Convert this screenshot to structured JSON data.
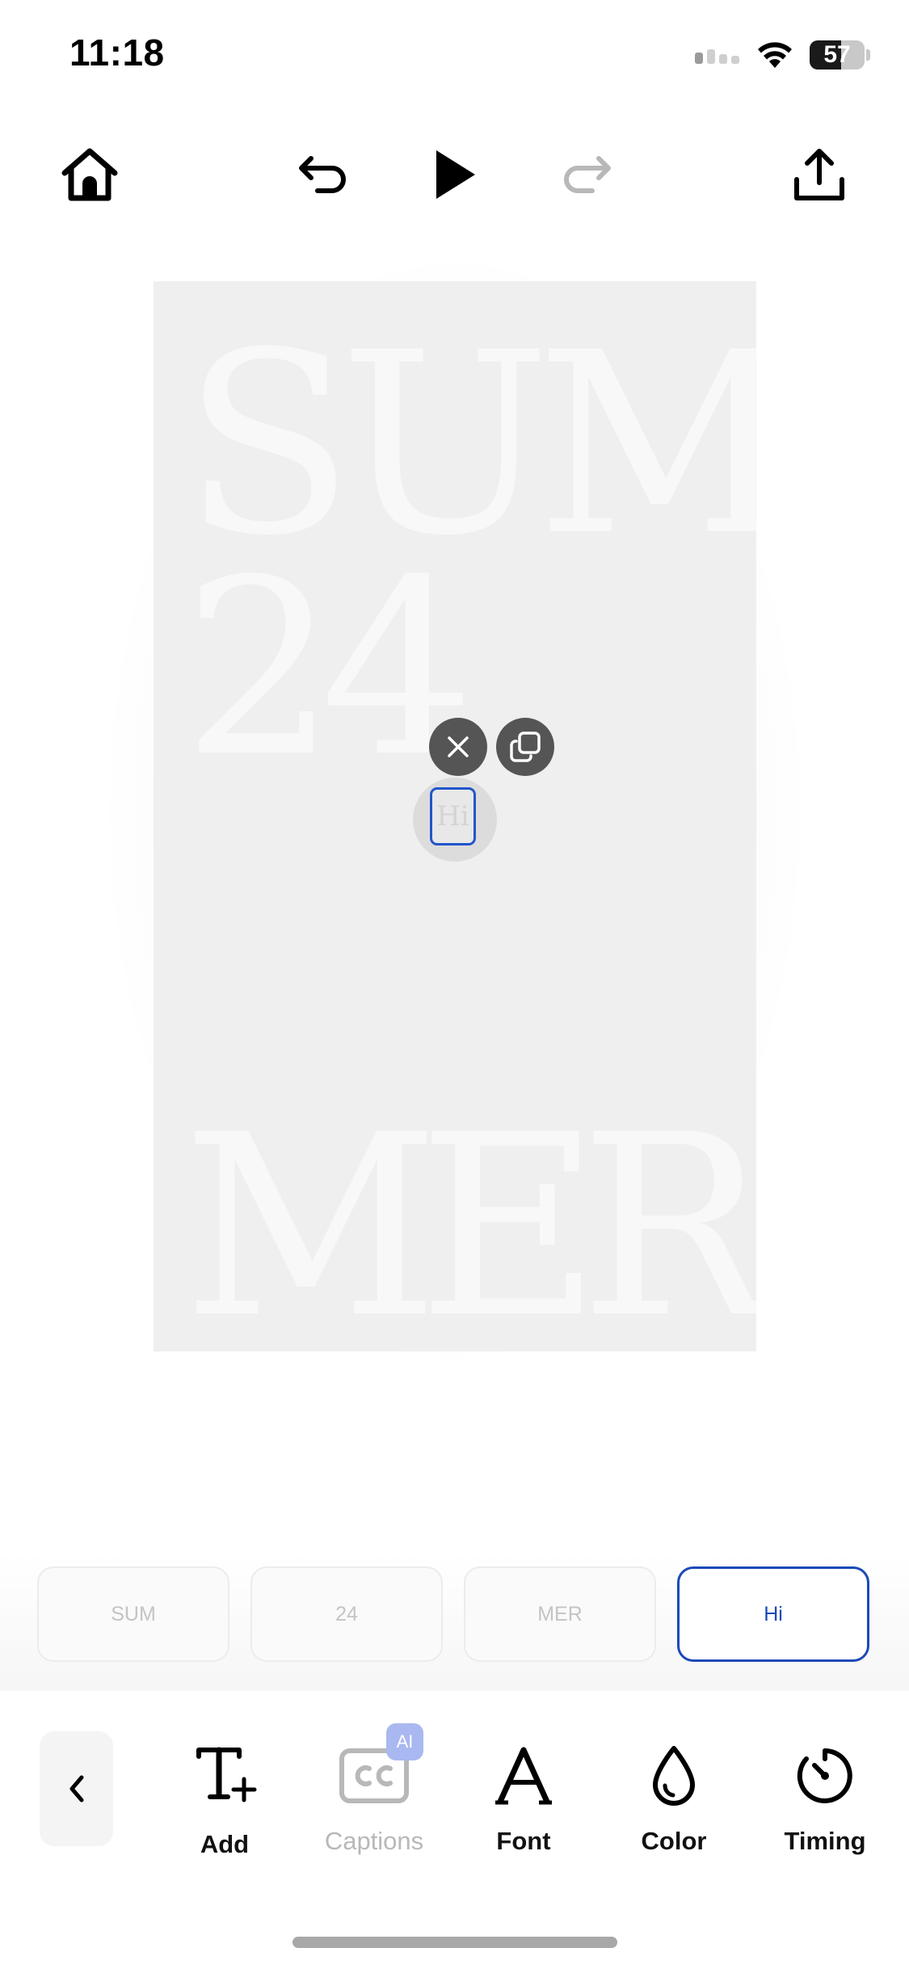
{
  "status_bar": {
    "time": "11:18",
    "battery_percent": "57",
    "battery_level": 0.57,
    "icons": [
      "cellular-signal-icon",
      "wifi-icon",
      "battery-icon"
    ]
  },
  "toolbar": {
    "icons": [
      "home-icon",
      "undo-icon",
      "play-icon",
      "redo-icon",
      "share-upload-icon"
    ],
    "redo_enabled": false
  },
  "canvas": {
    "background": "#efefef",
    "text_color": "#f8f8f8",
    "texts": {
      "line1": "SUM",
      "line2": "24",
      "line3": "MER",
      "selected": "Hi"
    },
    "selection_actions": [
      "close-icon",
      "duplicate-icon"
    ],
    "selection_color": "#2255cc"
  },
  "layers": {
    "items": [
      {
        "label": "SUM",
        "active": false
      },
      {
        "label": "24",
        "active": false
      },
      {
        "label": "MER",
        "active": false
      },
      {
        "label": "Hi",
        "active": true
      }
    ],
    "active_color": "#1c49b8"
  },
  "bottom_toolbar": {
    "back_icon": "chevron-left-icon",
    "tools": [
      {
        "label": "Add",
        "icon": "add-text-icon",
        "enabled": true
      },
      {
        "label": "Captions",
        "icon": "captions-cc-icon",
        "enabled": false,
        "badge": "AI"
      },
      {
        "label": "Font",
        "icon": "font-icon",
        "enabled": true
      },
      {
        "label": "Color",
        "icon": "color-drop-icon",
        "enabled": true
      },
      {
        "label": "Timing",
        "icon": "timing-icon",
        "enabled": true
      }
    ]
  }
}
